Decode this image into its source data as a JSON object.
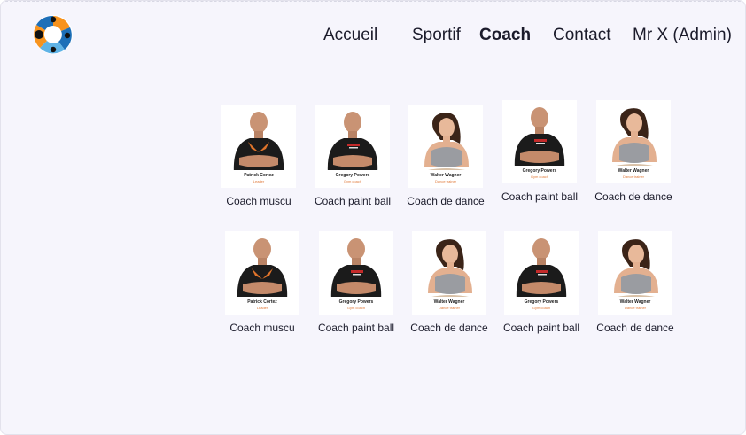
{
  "nav": {
    "items": [
      {
        "label": "Accueil",
        "active": false
      },
      {
        "label": "Sportif",
        "active": false
      },
      {
        "label": "Coach",
        "active": true
      },
      {
        "label": "Contact",
        "active": false
      },
      {
        "label": "Mr X (Admin)",
        "active": false
      }
    ]
  },
  "logo": {
    "icon": "people-circle-logo",
    "colors": [
      "#f7931e",
      "#1d6fb8",
      "#111111",
      "#5fb3e6"
    ]
  },
  "coaches": [
    {
      "name": "Patrick Cortez",
      "role": "Leader",
      "label": "Coach muscu",
      "photo": "man-crossed-arms-orange-shirt"
    },
    {
      "name": "Gregory Powers",
      "role": "Gym coach",
      "label": "Coach paint ball",
      "photo": "bald-man-crossed-arms-black-shirt"
    },
    {
      "name": "Walter Wagner",
      "role": "Dance trainer",
      "label": "Coach de dance",
      "photo": "woman-grey-sports-top"
    },
    {
      "name": "Gregory Powers",
      "role": "Gym coach",
      "label": "Coach paint ball",
      "photo": "bald-man-crossed-arms-black-shirt"
    },
    {
      "name": "Walter Wagner",
      "role": "Dance trainer",
      "label": "Coach de dance",
      "photo": "woman-grey-sports-top"
    },
    {
      "name": "Patrick Cortez",
      "role": "Leader",
      "label": "Coach muscu",
      "photo": "man-crossed-arms-orange-shirt"
    },
    {
      "name": "Gregory Powers",
      "role": "Gym coach",
      "label": "Coach paint ball",
      "photo": "bald-man-crossed-arms-black-shirt"
    },
    {
      "name": "Walter Wagner",
      "role": "Dance trainer",
      "label": "Coach de dance",
      "photo": "woman-grey-sports-top"
    },
    {
      "name": "Gregory Powers",
      "role": "Gym coach",
      "label": "Coach paint ball",
      "photo": "bald-man-crossed-arms-black-shirt"
    },
    {
      "name": "Walter Wagner",
      "role": "Dance trainer",
      "label": "Coach de dance",
      "photo": "woman-grey-sports-top"
    }
  ]
}
